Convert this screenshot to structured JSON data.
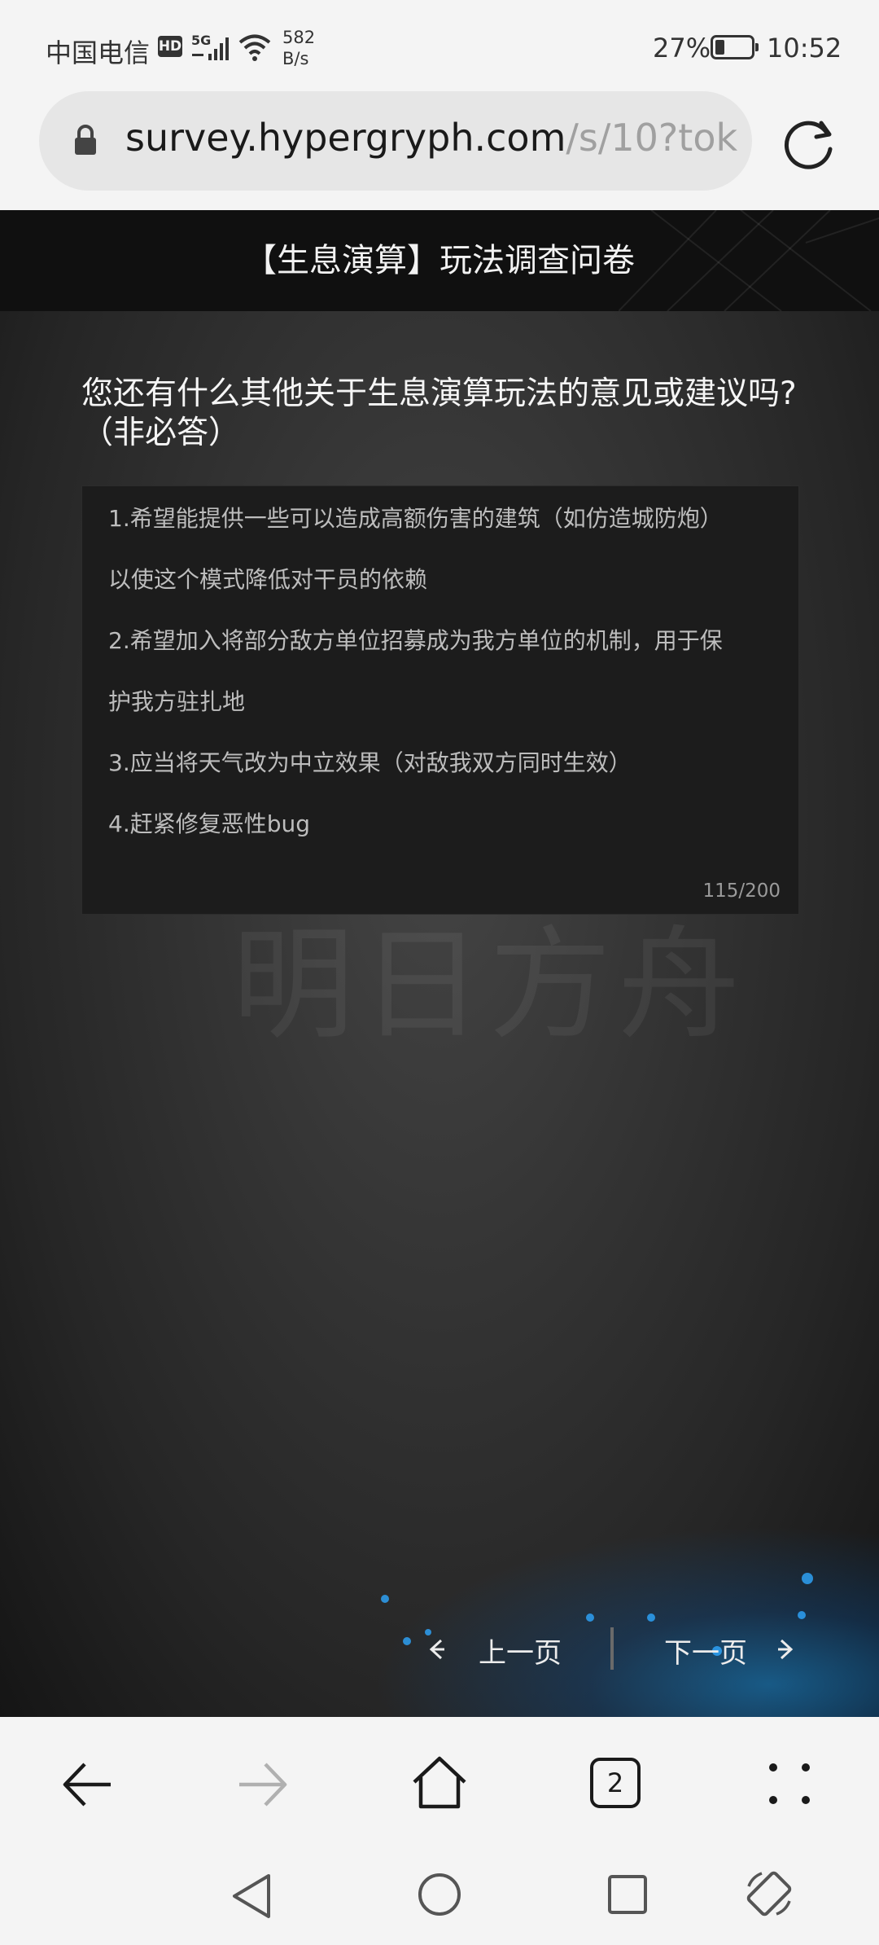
{
  "status_bar": {
    "carrier": "中国电信",
    "hd_badge": "HD",
    "net_type": "5G",
    "net_speed_value": "582",
    "net_speed_unit": "B/s",
    "battery_percent": "27%",
    "battery_level": 0.27,
    "time": "10:52"
  },
  "address_bar": {
    "url_host": "survey.hypergryph.com",
    "url_path": "/s/10?token"
  },
  "page": {
    "header_title": "【生息演算】玩法调查问卷",
    "question": "您还有什么其他关于生息演算玩法的意见或建议吗?（非必答）",
    "answer_lines": [
      "1.希望能提供一些可以造成高额伤害的建筑（如仿造城防炮）",
      "以使这个模式降低对干员的依赖",
      "2.希望加入将部分敌方单位招募成为我方单位的机制，用于保",
      "护我方驻扎地",
      "3.应当将天气改为中立效果（对敌我双方同时生效）",
      "4.赶紧修复恶性bug"
    ],
    "char_count": "115/200",
    "prev_label": "上一页",
    "next_label": "下一页"
  },
  "browser_toolbar": {
    "tab_count": "2"
  },
  "colors": {
    "accent_blue": "#2ea8ff",
    "header_bg": "#101010",
    "answer_bg": "#1c1c1c"
  },
  "icons": {
    "status": [
      "hd-icon",
      "signal-icon",
      "wifi-icon",
      "battery-icon"
    ],
    "toolbar": [
      "back-arrow-icon",
      "forward-arrow-icon",
      "home-icon",
      "tabs-icon",
      "menu-dots-icon"
    ],
    "system_nav": [
      "nav-back-icon",
      "nav-home-icon",
      "nav-recents-icon",
      "rotate-icon"
    ]
  }
}
